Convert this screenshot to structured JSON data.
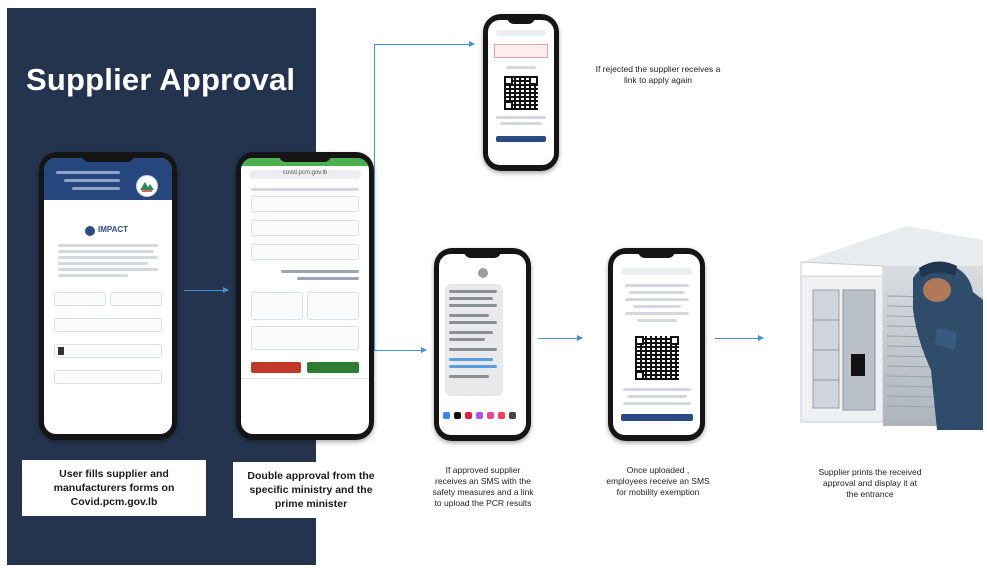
{
  "panel": {
    "title": "Supplier Approval",
    "background_color": "#24344f"
  },
  "phones": {
    "form": {
      "brand": "IMPACT",
      "icon": "impact-logo-icon"
    },
    "ministry": {
      "url": "covid.pcm.gov.lb"
    }
  },
  "steps": [
    {
      "id": "fill-forms",
      "text": "User fills supplier and manufacturers forms on Covid.pcm.gov.lb"
    },
    {
      "id": "double-approval",
      "text": "Double approval from the specific ministry and the prime minister"
    },
    {
      "id": "rejected",
      "text": "If rejected the supplier receives a\nlink to apply again"
    },
    {
      "id": "approved",
      "text": "If approved supplier\nreceives an SMS with the\nsafety measures and a link\nto upload the PCR results"
    },
    {
      "id": "uploaded",
      "text": "Once uploaded ,\nemployees receive an SMS\nfor mobility  exemption"
    },
    {
      "id": "prints",
      "text": "Supplier prints the received\napproval and display it at\nthe entrance"
    }
  ],
  "colors": {
    "arrow": "#4a8fd4",
    "accent_blue": "#2b4a86",
    "reject": "#c0392b",
    "approve": "#2e7d32"
  }
}
